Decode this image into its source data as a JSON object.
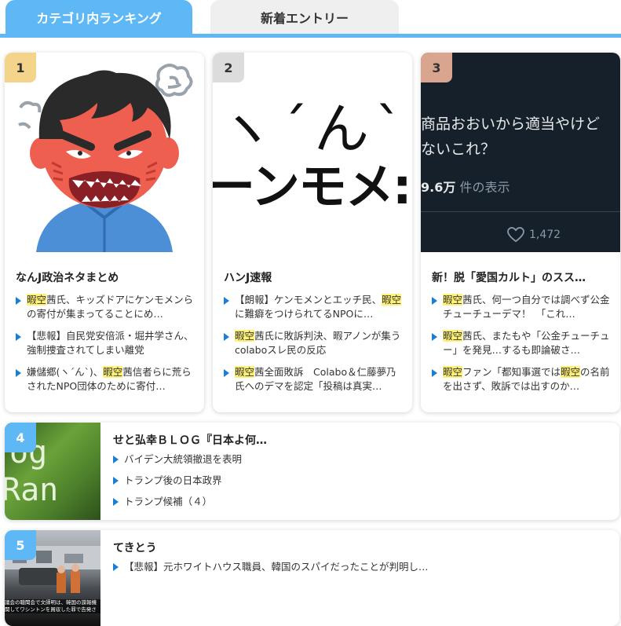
{
  "tabs": {
    "category_ranking": "カテゴリ内ランキング",
    "new_entries": "新着エントリー"
  },
  "colors": {
    "accent": "#5eb8f5",
    "rank1": "#f3d48a",
    "rank2": "#dcdcdc",
    "rank3": "#d9a58e",
    "highlight": "#fff176",
    "bullet": "#1a7fd4"
  },
  "cards": [
    {
      "rank": "1",
      "site": "なんJ政治ネタまとめ",
      "thumb_icon": "angry-man-illustration-icon",
      "entries": [
        {
          "pre": "",
          "hl": "暇空",
          "post": "茜氏、キッズドアにケンモメンらの寄付が集まってることにめ…"
        },
        {
          "pre": "【悲報】自民党安倍派・堀井学さん、強制捜査されてしまい離党",
          "hl": "",
          "post": ""
        },
        {
          "pre": "嫌儲郷(ヽ´ん`)、",
          "hl": "暇空",
          "post": "茜信者らに荒らされたNPO団体のために寄付…"
        }
      ]
    },
    {
      "rank": "2",
      "site": "ハンJ速報",
      "thumb": {
        "top": "ヽ´ん`",
        "bottom": "ーンモメ:"
      },
      "entries": [
        {
          "pre": "【朗報】ケンモメンとエッチ民、",
          "hl": "暇空",
          "post": "に難癖をつけられてるNPOに…"
        },
        {
          "pre": "",
          "hl": "暇空",
          "post": "茜氏に敗訴判決、暇アノンが集うcolaboスレ民の反応"
        },
        {
          "pre": "",
          "hl": "暇空",
          "post": "茜全面敗訴　Colabo＆仁藤夢乃氏へのデマを認定「投稿は真実…"
        }
      ]
    },
    {
      "rank": "3",
      "site": "新！脱「愛国カルト」のスス…",
      "thumb": {
        "line1": "商品おおいから適当やけど",
        "line2": "ないこれ？",
        "views_num": "9.6万",
        "views_label": " 件の表示",
        "likes": "1,472"
      },
      "entries": [
        {
          "pre": "",
          "hl": "暇空",
          "post": "茜氏、何一つ自分では調べず公金チューチューデマ！　「これ…"
        },
        {
          "pre": "",
          "hl": "暇空",
          "post": "茜氏、またもや「公金チューチュー」を発見…するも即論破さ…"
        },
        {
          "pre": "",
          "hl": "暇空",
          "post": "ファン「都知事選では",
          "hl2": "暇空",
          "post2": "の名前を出さず、敗訴では出すのか…"
        }
      ]
    }
  ],
  "wide_cards": [
    {
      "rank": "4",
      "site": "せと弘幸ＢＬＯＧ『日本よ何…",
      "thumb": {
        "t1": "og",
        "t2": "Ran"
      },
      "entries": [
        "バイデン大統領撤退を表明",
        "トランプ後の日本政界",
        "トランプ候補（４）"
      ]
    },
    {
      "rank": "5",
      "site": "てきとう",
      "thumb": {
        "caption1": "議会の聴聞会で文師明は、韓国の諜報機",
        "caption2": "関してワシントンを買収した罪で告発さ"
      },
      "entries": [
        "【悲報】元ホワイトハウス職員、韓国のスパイだったことが判明し…"
      ]
    }
  ]
}
